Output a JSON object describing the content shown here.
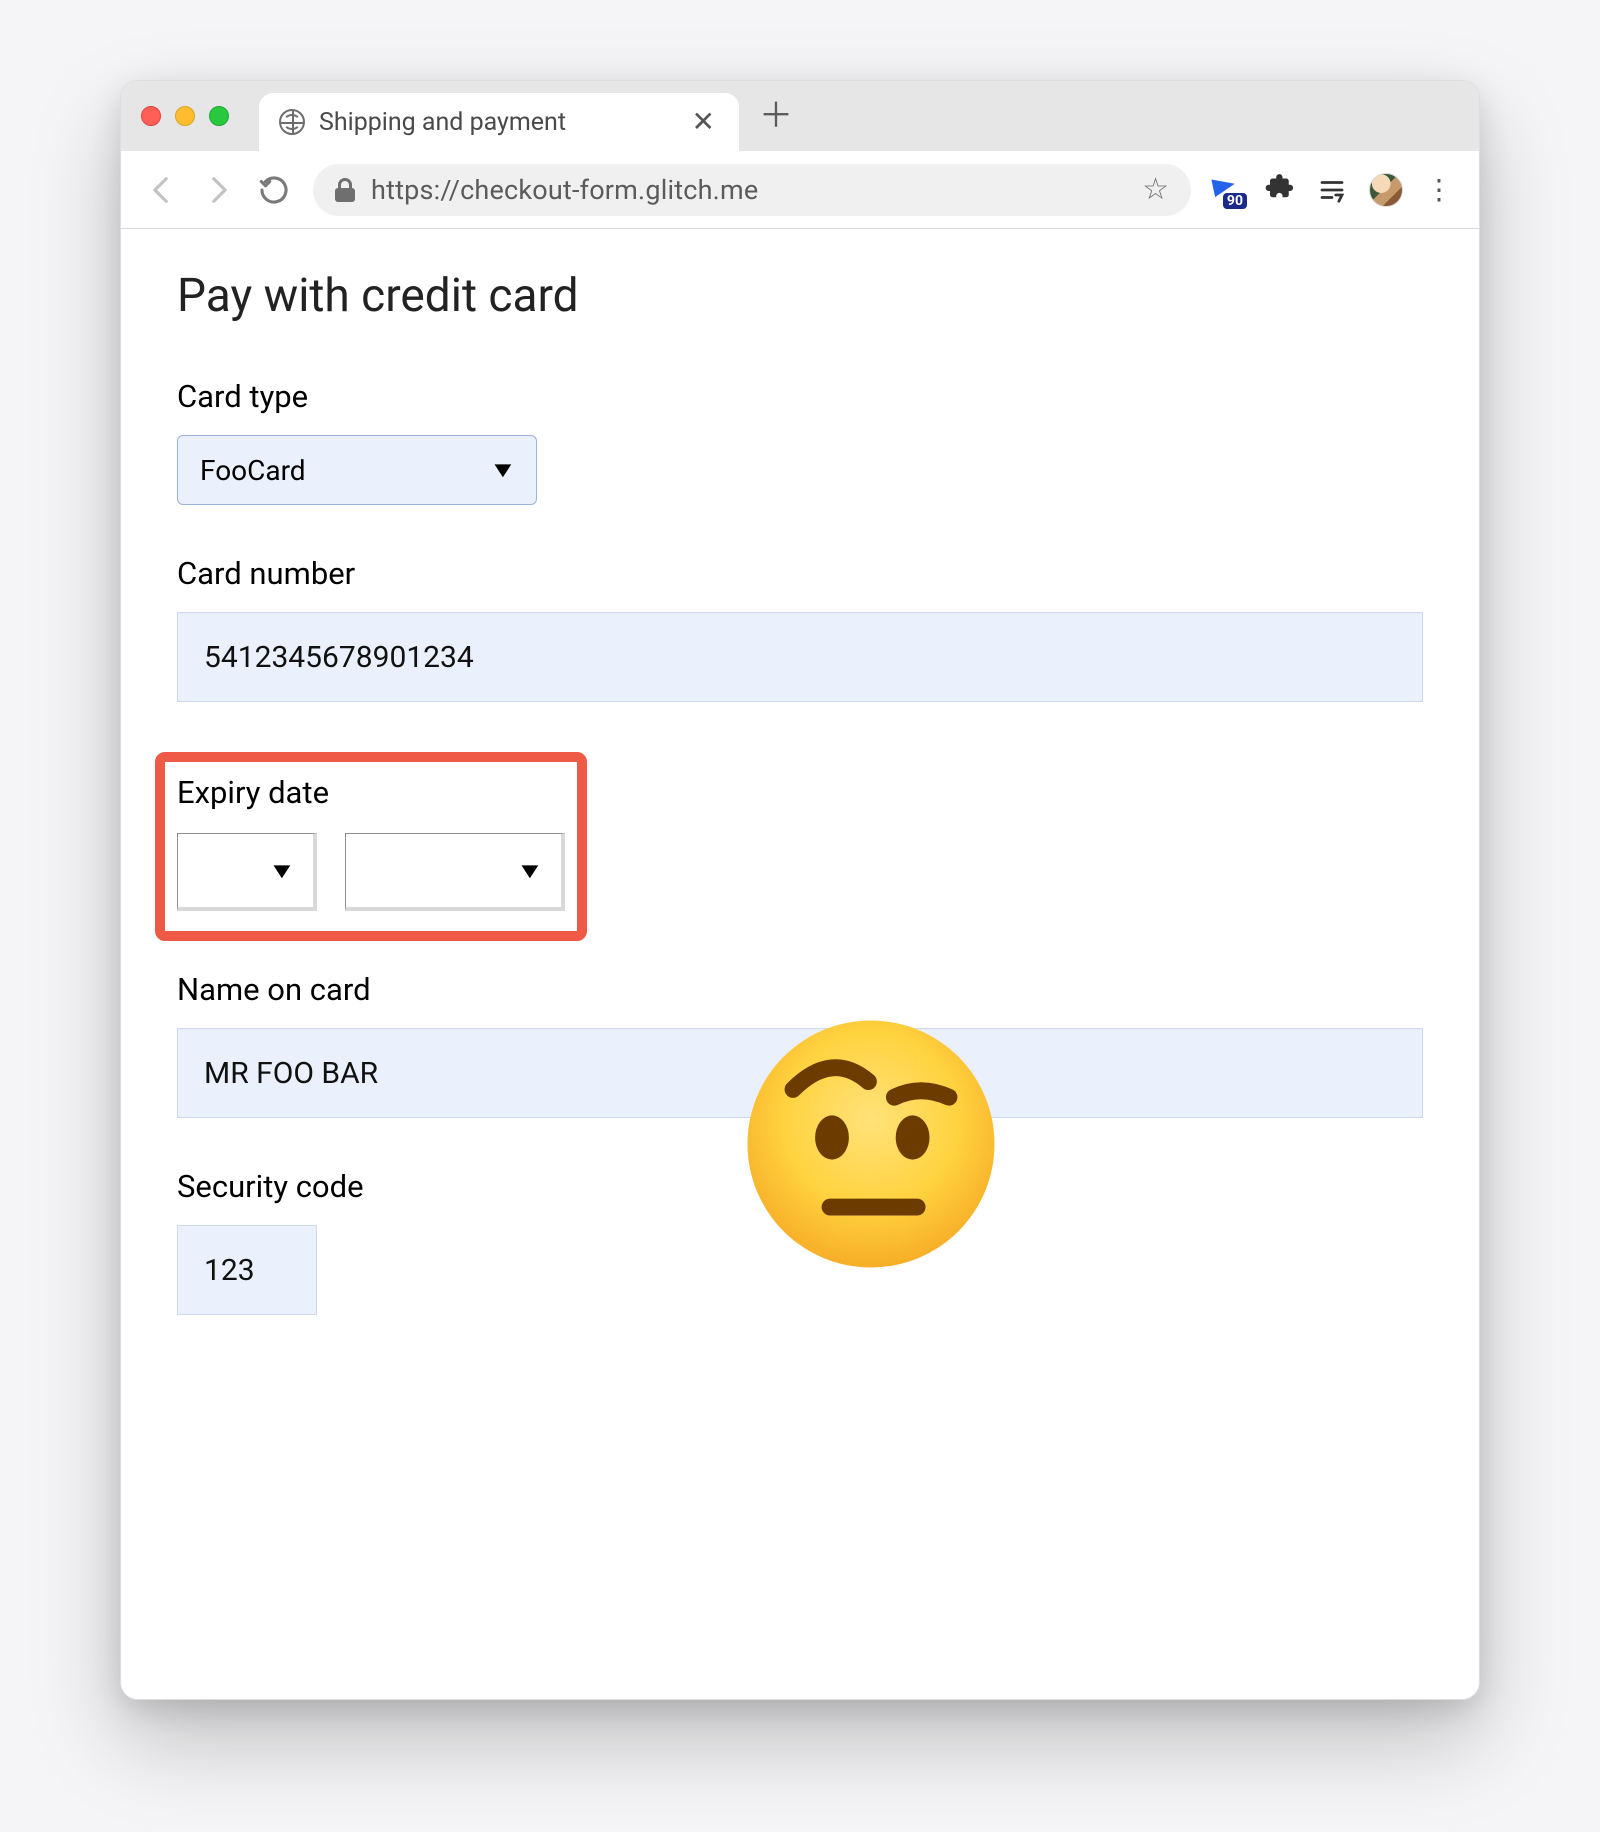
{
  "browser": {
    "tab_title": "Shipping and payment",
    "url": "https://checkout-form.glitch.me",
    "lighthouse_badge": "90"
  },
  "page": {
    "title": "Pay with credit card"
  },
  "form": {
    "card_type": {
      "label": "Card type",
      "value": "FooCard"
    },
    "card_number": {
      "label": "Card number",
      "value": "5412345678901234"
    },
    "expiry": {
      "label": "Expiry date",
      "month_value": "",
      "year_value": ""
    },
    "name_on_card": {
      "label": "Name on card",
      "value": "MR FOO BAR"
    },
    "security_code": {
      "label": "Security code",
      "value": "123"
    }
  },
  "annotation": {
    "emoji": "raised-eyebrow-face",
    "highlight_region": "expiry-date"
  }
}
